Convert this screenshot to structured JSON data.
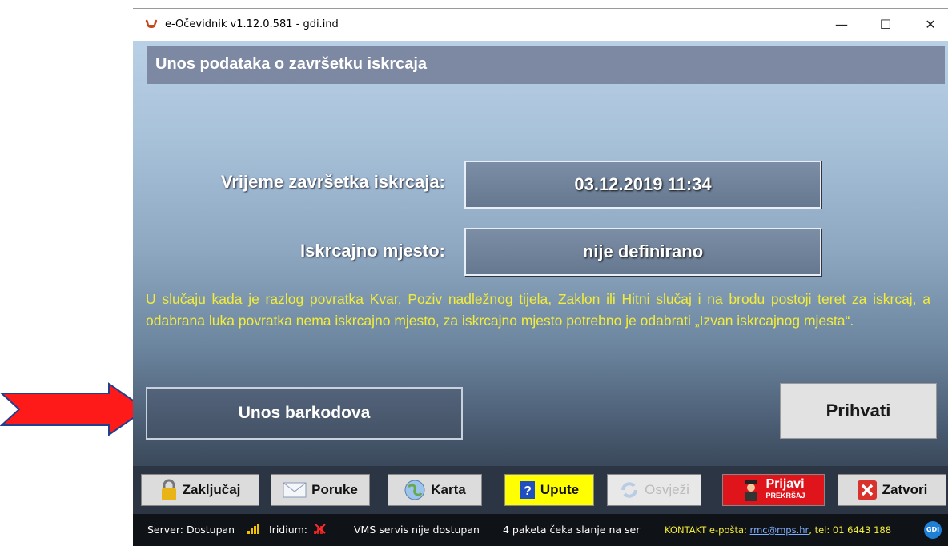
{
  "window": {
    "title": "e-Očevidnik v1.12.0.581 - gdi.ind",
    "minimize_glyph": "—",
    "maximize_glyph": "☐",
    "close_glyph": "✕"
  },
  "header": {
    "title": "Unos podataka o završetku iskrcaja"
  },
  "form": {
    "end_time_label": "Vrijeme završetka iskrcaja:",
    "end_time_value": "03.12.2019 11:34",
    "place_label": "Iskrcajno mjesto:",
    "place_value": "nije definirano"
  },
  "note": "U slučaju kada je razlog povratka Kvar, Poziv nadležnog tijela, Zaklon ili Hitni slučaj i na brodu postoji teret za iskrcaj, a odabrana luka povratka nema iskrcajno mjesto, za iskrcajno mjesto potrebno je odabrati „Izvan iskrcajnog mjesta“.",
  "actions": {
    "barcode_label": "Unos barkodova",
    "accept_label": "Prihvati"
  },
  "toolbar": {
    "lock": "Zaključaj",
    "messages": "Poruke",
    "map": "Karta",
    "help": "Upute",
    "refresh": "Osvježi",
    "report_main": "Prijavi",
    "report_sub": "PREKRŠAJ",
    "close": "Zatvori"
  },
  "status": {
    "server": "Server: Dostupan",
    "iridium": "Iridium:",
    "vms": "VMS servis nije dostupan",
    "packets": "4 paketa čeka slanje na ser",
    "contact_prefix": "KONTAKT e-pošta:",
    "contact_email": "rmc@mps.hr",
    "contact_phone": ", tel: 01 6443 188",
    "logo_text": "GDI"
  },
  "icons": [
    "app-crab-icon",
    "lock-icon",
    "envelope-icon",
    "map-icon",
    "help-icon",
    "refresh-icon",
    "inspector-icon",
    "close-x-icon",
    "signal-bars-icon",
    "no-signal-icon",
    "pointer-arrow-icon"
  ],
  "colors": {
    "accent_yellow": "#f2ec3a",
    "report_red": "#e0141b",
    "help_yellow": "#ffff00",
    "header_bar": "#7d88a2"
  }
}
